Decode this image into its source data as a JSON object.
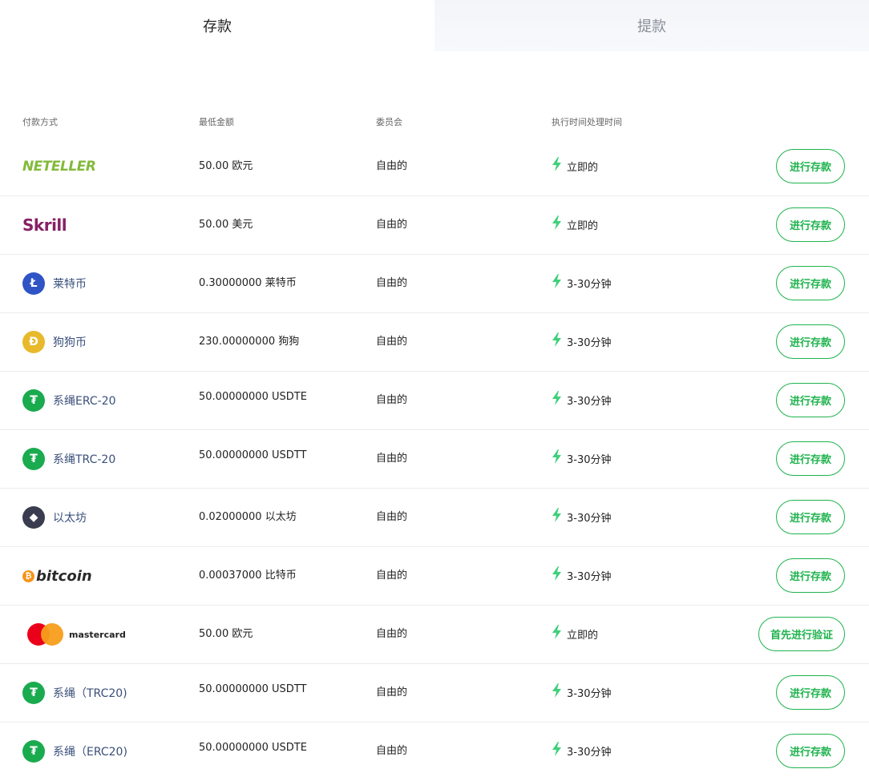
{
  "tabs": {
    "deposit": "存款",
    "withdraw": "提款"
  },
  "columns": {
    "method": "付款方式",
    "min": "最低金额",
    "fee": "委员会",
    "time": "执行时间处理时间"
  },
  "colors": {
    "accent": "#1fb34e",
    "bolt": "#3fd07a",
    "link": "#3a4f7a"
  },
  "rows": [
    {
      "logo": "NETELLER",
      "icon": "neteller-logo",
      "min": "50.00 欧元",
      "fee": "自由的",
      "time": "立即的",
      "button": "进行存款"
    },
    {
      "logo": "Skrill",
      "icon": "skrill-logo",
      "min": "50.00 美元",
      "fee": "自由的",
      "time": "立即的",
      "button": "进行存款"
    },
    {
      "name": "莱特币",
      "icon": "litecoin-icon",
      "color": "#2f54c6",
      "glyph": "Ł",
      "min": "0.30000000 莱特币",
      "fee": "自由的",
      "time": "3-30分钟",
      "button": "进行存款"
    },
    {
      "name": "狗狗币",
      "icon": "dogecoin-icon",
      "color": "#e8b92a",
      "glyph": "Ð",
      "min": "230.00000000 狗狗",
      "fee": "自由的",
      "time": "3-30分钟",
      "button": "进行存款"
    },
    {
      "name": "系绳ERC-20",
      "icon": "tether-icon",
      "color": "#1aab4f",
      "glyph": "₮",
      "min": "50.00000000 USDTE",
      "fee": "自由的",
      "time": "3-30分钟",
      "button": "进行存款"
    },
    {
      "name": "系绳TRC-20",
      "icon": "tether-icon",
      "color": "#1aab4f",
      "glyph": "₮",
      "min": "50.00000000 USDTT",
      "fee": "自由的",
      "time": "3-30分钟",
      "button": "进行存款"
    },
    {
      "name": "以太坊",
      "icon": "ethereum-icon",
      "color": "#3a3d4f",
      "glyph": "◆",
      "min": "0.02000000 以太坊",
      "fee": "自由的",
      "time": "3-30分钟",
      "button": "进行存款"
    },
    {
      "logo": "bitcoin",
      "icon": "bitcoin-logo",
      "min": "0.00037000 比特币",
      "fee": "自由的",
      "time": "3-30分钟",
      "button": "进行存款"
    },
    {
      "logo": "mastercard",
      "icon": "mastercard-logo",
      "min": "50.00 欧元",
      "fee": "自由的",
      "time": "立即的",
      "button": "首先进行验证"
    },
    {
      "name": "系绳（TRC20)",
      "icon": "tether-icon",
      "color": "#1aab4f",
      "glyph": "₮",
      "min": "50.00000000 USDTT",
      "fee": "自由的",
      "time": "3-30分钟",
      "button": "进行存款"
    },
    {
      "name": "系绳（ERC20)",
      "icon": "tether-icon",
      "color": "#1aab4f",
      "glyph": "₮",
      "min": "50.00000000 USDTE",
      "fee": "自由的",
      "time": "3-30分钟",
      "button": "进行存款"
    }
  ]
}
